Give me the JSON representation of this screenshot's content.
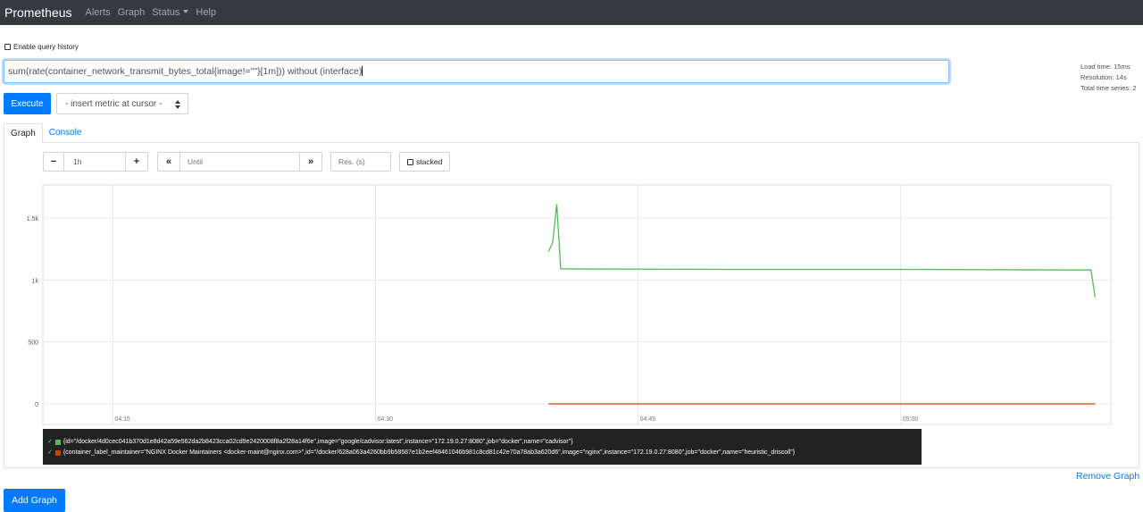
{
  "nav": {
    "brand": "Prometheus",
    "items": [
      "Alerts",
      "Graph",
      "Status",
      "Help"
    ]
  },
  "history_label": "Enable query history",
  "query": "sum(rate(container_network_transmit_bytes_total{image!=\"\"}[1m])) without (interface)",
  "stats": [
    "Load time: 15ms",
    "Resolution: 14s",
    "Total time series: 2"
  ],
  "execute_label": "Execute",
  "metric_select": "- insert metric at cursor -",
  "tabs": [
    "Graph",
    "Console"
  ],
  "controls": {
    "minus": "−",
    "range": "1h",
    "plus": "+",
    "back": "«",
    "until_placeholder": "Until",
    "forward": "»",
    "res_placeholder": "Res. (s)",
    "stacked": "stacked"
  },
  "chart_data": {
    "type": "line",
    "x_ticks": [
      "04:15",
      "04:30",
      "04:45",
      "05:00"
    ],
    "y_ticks": [
      "0",
      "500",
      "1k",
      "1.5k"
    ],
    "ylim": [
      0,
      1800
    ],
    "xlim": [
      "04:11",
      "05:12"
    ],
    "series": [
      {
        "color": "#5cb85c",
        "values": [
          {
            "t": "04:39:53",
            "v": 1230
          },
          {
            "t": "04:40:07",
            "v": 1300
          },
          {
            "t": "04:40:21",
            "v": 1610
          },
          {
            "t": "04:40:35",
            "v": 1090
          },
          {
            "t": "04:50:00",
            "v": 1085
          },
          {
            "t": "05:00:00",
            "v": 1085
          },
          {
            "t": "05:10:52",
            "v": 1080
          },
          {
            "t": "05:11:06",
            "v": 860
          }
        ]
      },
      {
        "color": "#cc4400",
        "values": [
          {
            "t": "04:39:53",
            "v": 0
          },
          {
            "t": "05:11:06",
            "v": 0
          }
        ]
      }
    ]
  },
  "legend": [
    {
      "color": "#5cb85c",
      "check": "✓",
      "label": "{id=\"/docker/4d0cec041b370d1e8d42a59e562da2b8423cca02cd9e2420008f8a2f28a14f6e\",image=\"google/cadvisor:latest\",instance=\"172.19.0.27:8080\",job=\"docker\",name=\"cadvisor\"}"
    },
    {
      "color": "#cc4400",
      "check": "✓",
      "label": "{container_label_maintainer=\"NGINX Docker Maintainers <docker-maint@nginx.com>\",id=\"/docker/628a063a4260bb9b58587e1b2eef48461046b981c8cd81c42e70a78ab3a620d6\",image=\"nginx\",instance=\"172.19.0.27:8080\",job=\"docker\",name=\"heuristic_driscoll\"}"
    }
  ],
  "remove_graph": "Remove Graph",
  "add_graph": "Add Graph"
}
